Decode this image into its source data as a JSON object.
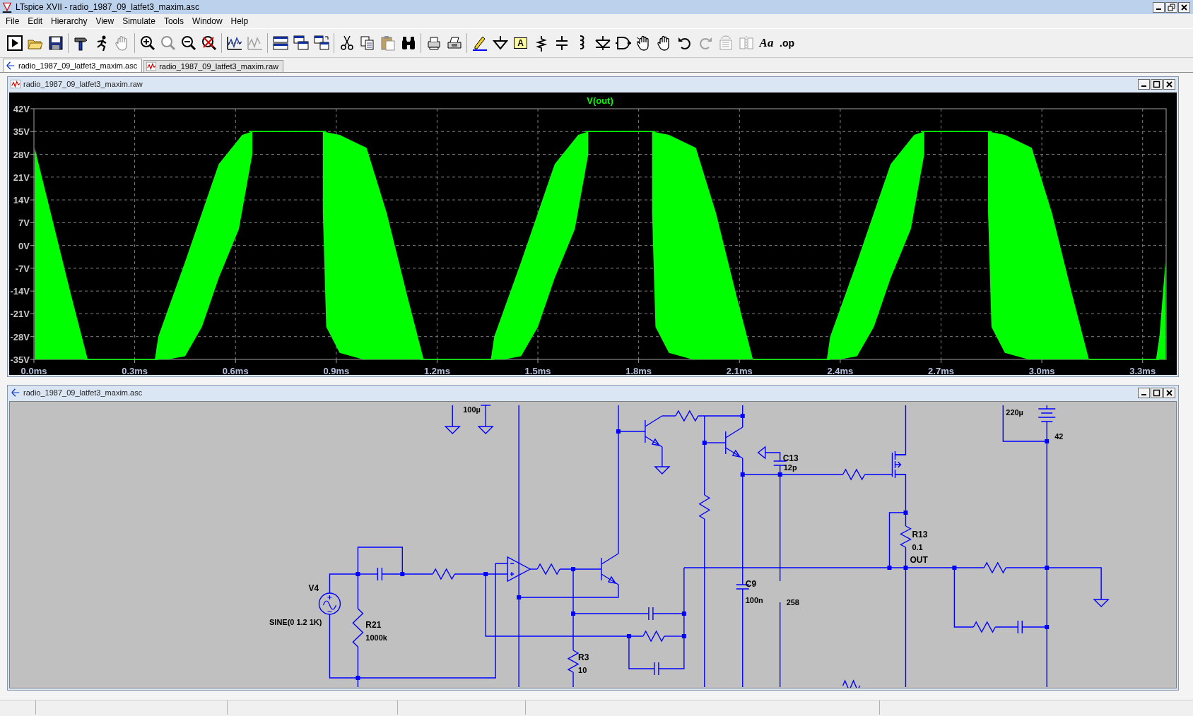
{
  "window": {
    "title": "LTspice XVII - radio_1987_09_latfet3_maxim.asc"
  },
  "menu": [
    {
      "label": "File"
    },
    {
      "label": "Edit"
    },
    {
      "label": "Hierarchy"
    },
    {
      "label": "View"
    },
    {
      "label": "Simulate"
    },
    {
      "label": "Tools"
    },
    {
      "label": "Window"
    },
    {
      "label": "Help"
    }
  ],
  "toolbar": {
    "label_glyph": "A",
    "font_glyph": "Aa",
    "directive_glyph": ".op"
  },
  "tabs": [
    {
      "label": "radio_1987_09_latfet3_maxim.asc",
      "kind": "schematic",
      "selected": true
    },
    {
      "label": "radio_1987_09_latfet3_maxim.raw",
      "kind": "waveform",
      "selected": false
    }
  ],
  "waveform_window": {
    "title": "radio_1987_09_latfet3_maxim.raw",
    "kind": "waveform",
    "trace": "V(out)",
    "y_ticks": [
      "42V",
      "35V",
      "28V",
      "21V",
      "14V",
      "7V",
      "0V",
      "-7V",
      "-14V",
      "-21V",
      "-28V",
      "-35V"
    ],
    "x_ticks": [
      "0.0ms",
      "0.3ms",
      "0.6ms",
      "0.9ms",
      "1.2ms",
      "1.5ms",
      "1.8ms",
      "2.1ms",
      "2.4ms",
      "2.7ms",
      "3.0ms",
      "3.3ms"
    ]
  },
  "schematic_window": {
    "title": "radio_1987_09_latfet3_maxim.asc",
    "kind": "schematic",
    "labels": [
      {
        "text": "100µ",
        "kind": "value"
      },
      {
        "text": "V4",
        "kind": "name"
      },
      {
        "text": "SINE(0 1.2 1K)",
        "kind": "value"
      },
      {
        "text": "R21",
        "kind": "name"
      },
      {
        "text": "1000k",
        "kind": "value"
      },
      {
        "text": "R3",
        "kind": "name"
      },
      {
        "text": "10",
        "kind": "value"
      },
      {
        "text": "C13",
        "kind": "name"
      },
      {
        "text": "12p",
        "kind": "value"
      },
      {
        "text": "C9",
        "kind": "name"
      },
      {
        "text": "100n",
        "kind": "value"
      },
      {
        "text": "258",
        "kind": "value"
      },
      {
        "text": "R13",
        "kind": "name"
      },
      {
        "text": "0.1",
        "kind": "value"
      },
      {
        "text": "OUT",
        "kind": "net"
      },
      {
        "text": "220µ",
        "kind": "value"
      },
      {
        "text": "42",
        "kind": "value"
      }
    ]
  }
}
